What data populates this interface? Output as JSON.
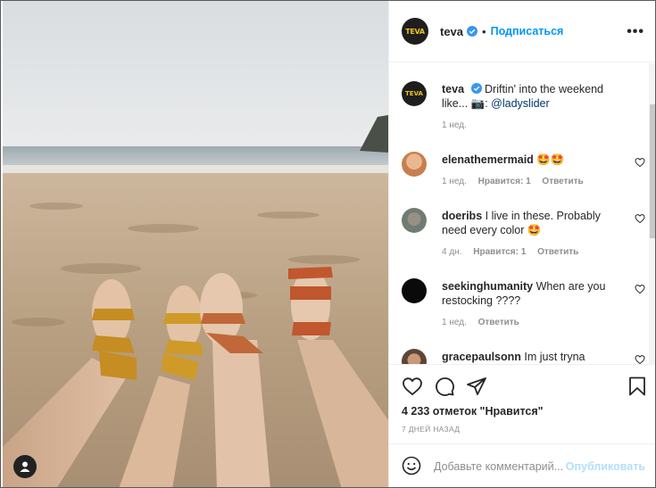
{
  "post": {
    "username": "teva",
    "logo_text": "TEVA",
    "follow_label": "Подписаться",
    "dot": "•",
    "more_label": "•••"
  },
  "caption": {
    "username": "teva",
    "text": "Driftin' into the weekend like... 📷: ",
    "mention": "@ladyslider",
    "time": "1 нед."
  },
  "comments": [
    {
      "username": "elenathemermaid",
      "text": "🤩🤩",
      "time": "1 нед.",
      "likes": "Нравится: 1",
      "reply": "Ответить"
    },
    {
      "username": "doeribs",
      "text": "I live in these. Probably need every color 🤩",
      "time": "4 дн.",
      "likes": "Нравится: 1",
      "reply": "Ответить"
    },
    {
      "username": "seekinghumanity",
      "text": "When are you restocking ????",
      "time": "1 нед.",
      "likes": "",
      "reply": "Ответить"
    },
    {
      "username": "gracepaulsonn",
      "text": "Im just tryna",
      "time": "",
      "likes": "",
      "reply": ""
    }
  ],
  "stats": {
    "likes_text": "4 233 отметок \"Нравится\"",
    "date": "7 ДНЕЙ НАЗАД"
  },
  "add_comment": {
    "placeholder": "Добавьте комментарий...",
    "publish": "Опубликовать"
  },
  "colors": {
    "accent": "#0095f6",
    "verified": "#3897f0",
    "muted": "#8e8e8e",
    "publish_disabled": "#b2dffc"
  }
}
